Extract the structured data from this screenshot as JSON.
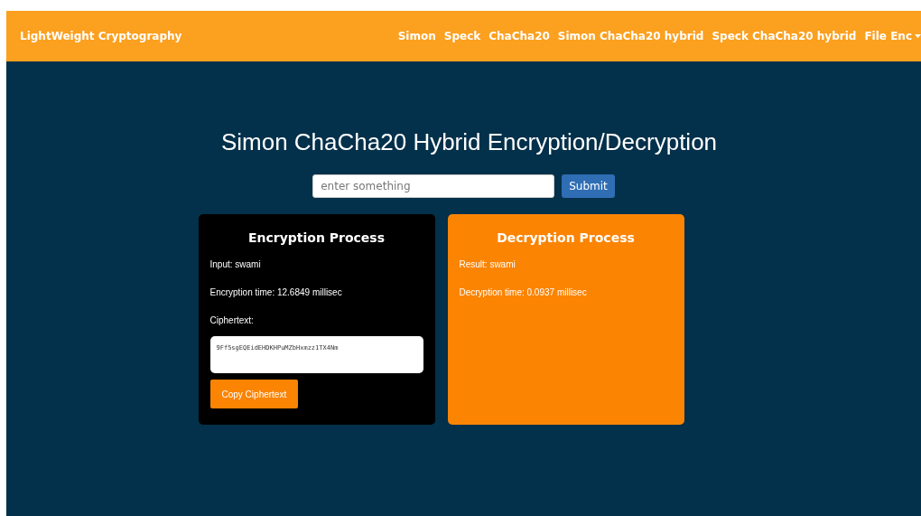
{
  "navbar": {
    "brand": "LightWeight Cryptography",
    "links": [
      {
        "label": "Simon",
        "kind": "link"
      },
      {
        "label": "Speck",
        "kind": "link"
      },
      {
        "label": "ChaCha20",
        "kind": "link"
      },
      {
        "label": "Simon ChaCha20 hybrid",
        "kind": "link"
      },
      {
        "label": "Speck ChaCha20 hybrid",
        "kind": "link"
      },
      {
        "label": "File Enc",
        "kind": "dropdown"
      }
    ]
  },
  "title": "Simon ChaCha20 Hybrid Encryption/Decryption",
  "form": {
    "placeholder": "enter something",
    "submit": "Submit"
  },
  "encryption": {
    "heading": "Encryption Process",
    "input": "Input: swami",
    "time": "Encryption time: 12.6849 millisec",
    "cipher_label": "Ciphertext:",
    "ciphertext": "9Ff5sgEQEidEHDKHPuMZbHxmzz1TX4Nm",
    "copy_button": "Copy Ciphertext"
  },
  "decryption": {
    "heading": "Decryption Process",
    "result": "Result: swami",
    "time": "Decryption time: 0.0937 millisec"
  }
}
